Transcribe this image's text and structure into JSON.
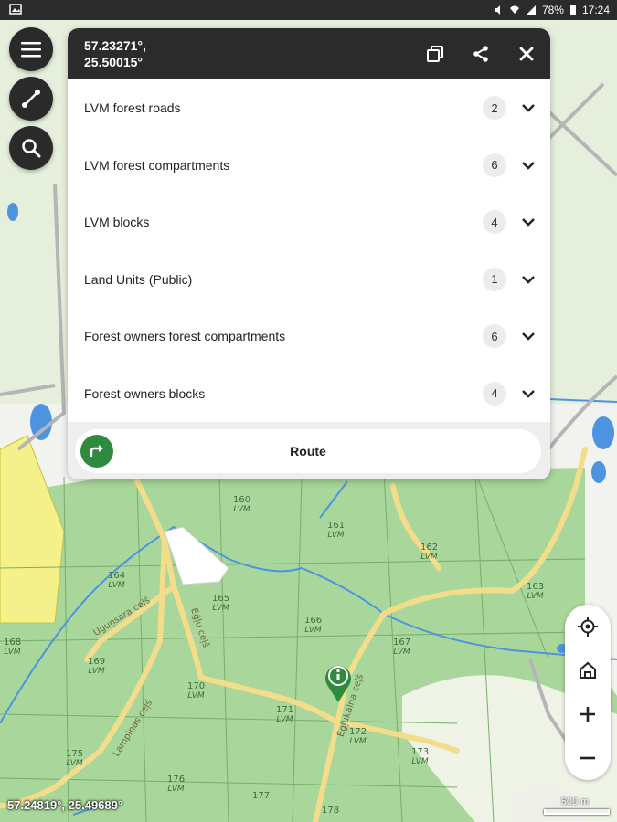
{
  "status_bar": {
    "time": "17:24",
    "battery": "78%"
  },
  "info_panel": {
    "coordinates_line1": "57.23271°,",
    "coordinates_line2": "25.50015°",
    "layers": [
      {
        "name": "LVM forest roads",
        "count": "2"
      },
      {
        "name": "LVM forest compartments",
        "count": "6"
      },
      {
        "name": "LVM blocks",
        "count": "4"
      },
      {
        "name": "Land Units (Public)",
        "count": "1"
      },
      {
        "name": "Forest owners forest compartments",
        "count": "6"
      },
      {
        "name": "Forest owners blocks",
        "count": "4"
      }
    ],
    "route_label": "Route"
  },
  "map": {
    "compartment_labels": [
      {
        "num": "160",
        "sub": "LVM"
      },
      {
        "num": "161",
        "sub": "LVM"
      },
      {
        "num": "162",
        "sub": "LVM"
      },
      {
        "num": "163",
        "sub": "LVM"
      },
      {
        "num": "164",
        "sub": "LVM"
      },
      {
        "num": "165",
        "sub": "LVM"
      },
      {
        "num": "166",
        "sub": "LVM"
      },
      {
        "num": "167",
        "sub": "LVM"
      },
      {
        "num": "168",
        "sub": "LVM"
      },
      {
        "num": "169",
        "sub": "LVM"
      },
      {
        "num": "170",
        "sub": "LVM"
      },
      {
        "num": "171",
        "sub": "LVM"
      },
      {
        "num": "172",
        "sub": "LVM"
      },
      {
        "num": "173",
        "sub": "LVM"
      },
      {
        "num": "175",
        "sub": "LVM"
      },
      {
        "num": "176",
        "sub": "LVM"
      },
      {
        "num": "177",
        "sub": ""
      },
      {
        "num": "178",
        "sub": ""
      }
    ],
    "road_names": [
      "Uguņsara ceļš",
      "Lampiņas ceļš",
      "Egļukalna ceļš",
      "Eģļu ceļš"
    ],
    "pin_icon": "info-pin-icon",
    "bottom_coordinates": "57.24819°, 25.49689°",
    "scale_label": "500 m"
  },
  "colors": {
    "forest": "#a9d69a",
    "road": "#f3dd8a",
    "water": "#4d94e0",
    "route_green": "#2e8b3e",
    "panel_header": "#2b2b2b"
  }
}
